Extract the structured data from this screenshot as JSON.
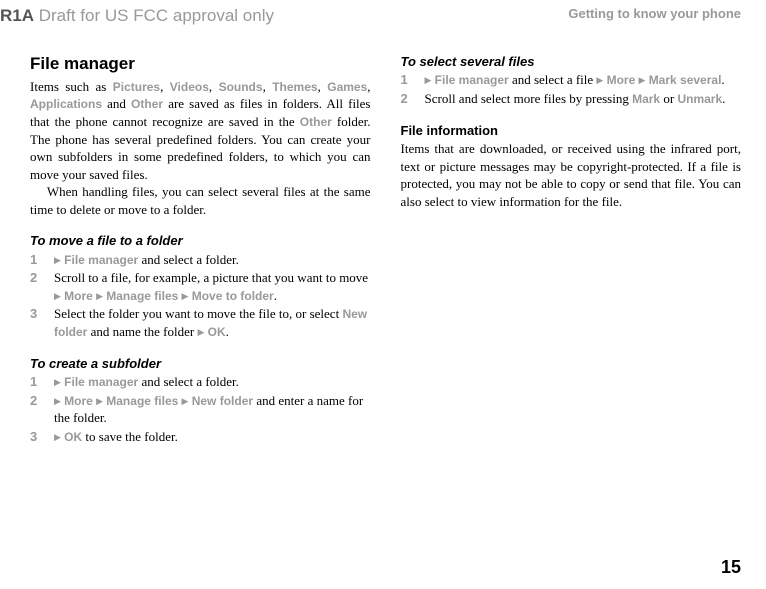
{
  "header": {
    "r1a": "R1A",
    "draft": " Draft for US FCC approval only",
    "right": "Getting to know your phone"
  },
  "left": {
    "h1": "File manager",
    "p1_a": "Items such as ",
    "p1_pictures": "Pictures",
    "p1_c1": ", ",
    "p1_videos": "Videos",
    "p1_c2": ", ",
    "p1_sounds": "Sounds",
    "p1_c3": ", ",
    "p1_themes": "Themes",
    "p1_c4": ", ",
    "p1_games": "Games",
    "p1_c5": ", ",
    "p1_apps": "Applications",
    "p1_and": " and ",
    "p1_other": "Other",
    "p1_b": " are saved as files in folders. All files that the phone cannot recognize are saved in the ",
    "p1_other2": "Other",
    "p1_c": " folder. The phone has several predefined folders. You can create your own subfolders in some predefined folders, to which you can move your saved files.",
    "p2": "When handling files, you can select several files at the same time to delete or move to a folder.",
    "h2_move": "To move a file to a folder",
    "m1_fm": "File manager",
    "m1_b": " and select a folder.",
    "m2_a": "Scroll to a file, for example, a picture that you want to move ",
    "m2_more": "More",
    "m2_manage": "Manage files",
    "m2_moveto": "Move to folder",
    "m2_dot": ".",
    "m3_a": "Select the folder you want to move the file to, or select ",
    "m3_new": "New folder",
    "m3_b": " and name the folder ",
    "m3_ok": "OK",
    "m3_dot": ".",
    "h2_create": "To create a subfolder",
    "c1_fm": "File manager",
    "c1_b": " and select a folder.",
    "c2_more": "More",
    "c2_manage": "Manage files",
    "c2_new": "New folder",
    "c2_b": " and enter a name for the folder.",
    "c3_ok": "OK",
    "c3_b": " to save the folder."
  },
  "right": {
    "h2_select": "To select several files",
    "s1_fm": "File manager",
    "s1_b": " and select a file ",
    "s1_more": "More",
    "s1_mark": "Mark several",
    "s1_dot": ".",
    "s2_a": "Scroll and select more files by pressing ",
    "s2_mark": "Mark",
    "s2_or": " or ",
    "s2_unmark": "Unmark",
    "s2_dot": ".",
    "h3_info": "File information",
    "p_info": "Items that are downloaded, or received using the infrared port, text or picture messages may be copyright-protected. If a file is protected, you may not be able to copy or send that file. You can also select to view information for the file."
  },
  "nums": {
    "n1": "1",
    "n2": "2",
    "n3": "3"
  },
  "arrow": "▶",
  "pagenum": "15"
}
